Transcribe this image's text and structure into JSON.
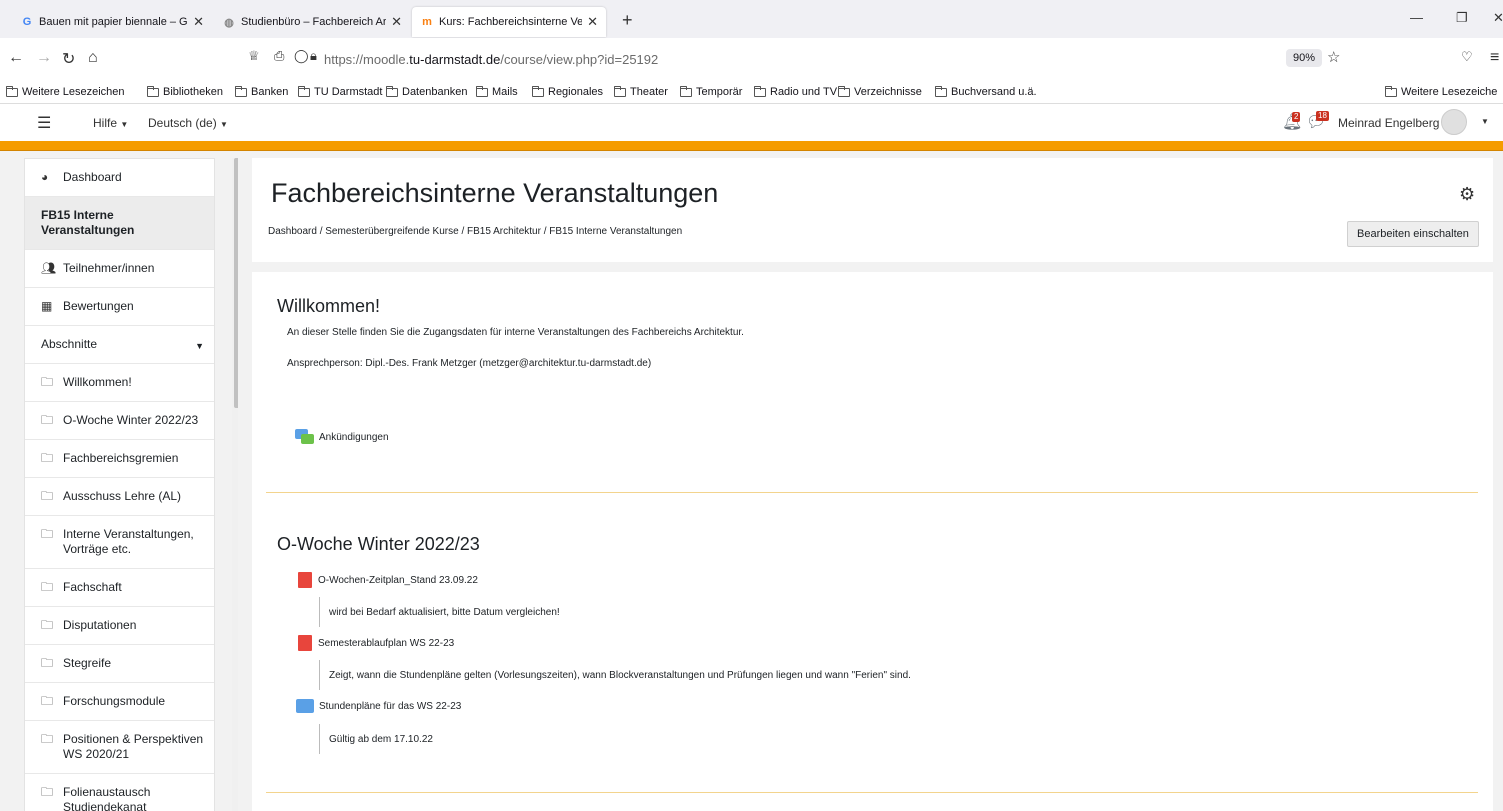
{
  "browser": {
    "tabs": [
      {
        "label": "Bauen mit papier biennale – Go",
        "icon": "google-icon"
      },
      {
        "label": "Studienbüro – Fachbereich Arch",
        "icon": "globe-icon"
      },
      {
        "label": "Kurs: Fachbereichsinterne Veran",
        "icon": "moodle-icon"
      }
    ],
    "new_tab": "+",
    "url_prefix": "https://moodle.",
    "url_domain": "tu-darmstadt.de",
    "url_path": "/course/view.php?id=25192",
    "zoom": "90%",
    "bookmarks": [
      "Weitere Lesezeichen",
      "Bibliotheken",
      "Banken",
      "TU Darmstadt",
      "Datenbanken",
      "Mails",
      "Regionales",
      "Theater",
      "Temporär",
      "Radio und TV",
      "Verzeichnisse",
      "Buchversand u.ä."
    ],
    "bookmarks_right": "Weitere Lesezeiche"
  },
  "header": {
    "help": "Hilfe",
    "language": "Deutsch (de)",
    "notifications_count": "2",
    "messages_count": "18",
    "user_name": "Meinrad Engelberg"
  },
  "drawer": {
    "items": [
      {
        "label": "Dashboard",
        "icon": "dashboard-icon"
      },
      {
        "label": "FB15 Interne Veranstaltungen",
        "icon": ""
      },
      {
        "label": "Teilnehmer/innen",
        "icon": "users-icon"
      },
      {
        "label": "Bewertungen",
        "icon": "table-icon"
      },
      {
        "label": "Abschnitte",
        "icon": ""
      },
      {
        "label": "Willkommen!",
        "icon": "folder-icon"
      },
      {
        "label": "O-Woche Winter 2022/23",
        "icon": "folder-icon"
      },
      {
        "label": "Fachbereichsgremien",
        "icon": "folder-icon"
      },
      {
        "label": "Ausschuss Lehre (AL)",
        "icon": "folder-icon"
      },
      {
        "label": "Interne Veranstaltungen, Vorträge etc.",
        "icon": "folder-icon"
      },
      {
        "label": "Fachschaft",
        "icon": "folder-icon"
      },
      {
        "label": "Disputationen",
        "icon": "folder-icon"
      },
      {
        "label": "Stegreife",
        "icon": "folder-icon"
      },
      {
        "label": "Forschungsmodule",
        "icon": "folder-icon"
      },
      {
        "label": "Positionen & Perspektiven WS 2020/21",
        "icon": "folder-icon"
      },
      {
        "label": "Folienaustausch Studiendekanat",
        "icon": "folder-icon"
      }
    ]
  },
  "course": {
    "title": "Fachbereichsinterne Veranstaltungen",
    "breadcrumb": "Dashboard  /  Semesterübergreifende Kurse  /  FB15 Architektur  /  FB15 Interne Veranstaltungen",
    "edit_button": "Bearbeiten einschalten"
  },
  "sections": {
    "welcome": {
      "title": "Willkommen!",
      "text1": "An dieser Stelle finden Sie die Zugangsdaten für interne Veranstaltungen des Fachbereichs Architektur.",
      "text2": "Ansprechperson: Dipl.-Des. Frank Metzger (metzger@architektur.tu-darmstadt.de)",
      "forum": "Ankündigungen"
    },
    "owoche": {
      "title": "O-Woche Winter 2022/23",
      "act1": "O-Wochen-Zeitplan_Stand 23.09.22",
      "desc1": "wird bei Bedarf aktualisiert, bitte Datum vergleichen!",
      "act2": "Semesterablaufplan WS 22-23",
      "desc2": "Zeigt, wann die Stundenpläne gelten (Vorlesungszeiten), wann Blockveranstaltungen und Prüfungen liegen und wann \"Ferien\" sind.",
      "act3": "Stundenpläne für das WS 22-23",
      "desc3": "Gültig ab dem 17.10.22"
    }
  }
}
